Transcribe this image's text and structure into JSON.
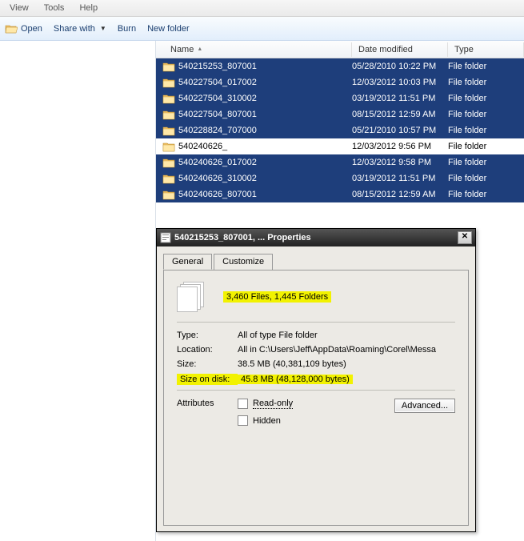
{
  "menu": {
    "view": "View",
    "tools": "Tools",
    "help": "Help"
  },
  "toolbar": {
    "open": "Open",
    "share": "Share with",
    "burn": "Burn",
    "newfolder": "New folder"
  },
  "columns": {
    "name": "Name",
    "date": "Date modified",
    "type": "Type"
  },
  "files": [
    {
      "name": "540215253_807001",
      "date": "05/28/2010 10:22 PM",
      "type": "File folder",
      "sel": true
    },
    {
      "name": "540227504_017002",
      "date": "12/03/2012 10:03 PM",
      "type": "File folder",
      "sel": true
    },
    {
      "name": "540227504_310002",
      "date": "03/19/2012 11:51 PM",
      "type": "File folder",
      "sel": true
    },
    {
      "name": "540227504_807001",
      "date": "08/15/2012 12:59 AM",
      "type": "File folder",
      "sel": true
    },
    {
      "name": "540228824_707000",
      "date": "05/21/2010 10:57 PM",
      "type": "File folder",
      "sel": true
    },
    {
      "name": "540240626_",
      "date": "12/03/2012 9:56 PM",
      "type": "File folder",
      "sel": false
    },
    {
      "name": "540240626_017002",
      "date": "12/03/2012 9:58 PM",
      "type": "File folder",
      "sel": true
    },
    {
      "name": "540240626_310002",
      "date": "03/19/2012 11:51 PM",
      "type": "File folder",
      "sel": true
    },
    {
      "name": "540240626_807001",
      "date": "08/15/2012 12:59 AM",
      "type": "File folder",
      "sel": true
    }
  ],
  "dialog": {
    "title": "540215253_807001, ... Properties",
    "tabs": {
      "general": "General",
      "customize": "Customize"
    },
    "summary": "3,460 Files, 1,445 Folders",
    "rows": {
      "type_label": "Type:",
      "type_val": "All of type File folder",
      "loc_label": "Location:",
      "loc_val": "All in C:\\Users\\Jeff\\AppData\\Roaming\\Corel\\Messa",
      "size_label": "Size:",
      "size_val": "38.5 MB (40,381,109 bytes)",
      "sod_label": "Size on disk:",
      "sod_val": "45.8 MB (48,128,000 bytes)"
    },
    "attributes": {
      "label": "Attributes",
      "readonly": "Read-only",
      "hidden": "Hidden",
      "advanced": "Advanced..."
    }
  }
}
